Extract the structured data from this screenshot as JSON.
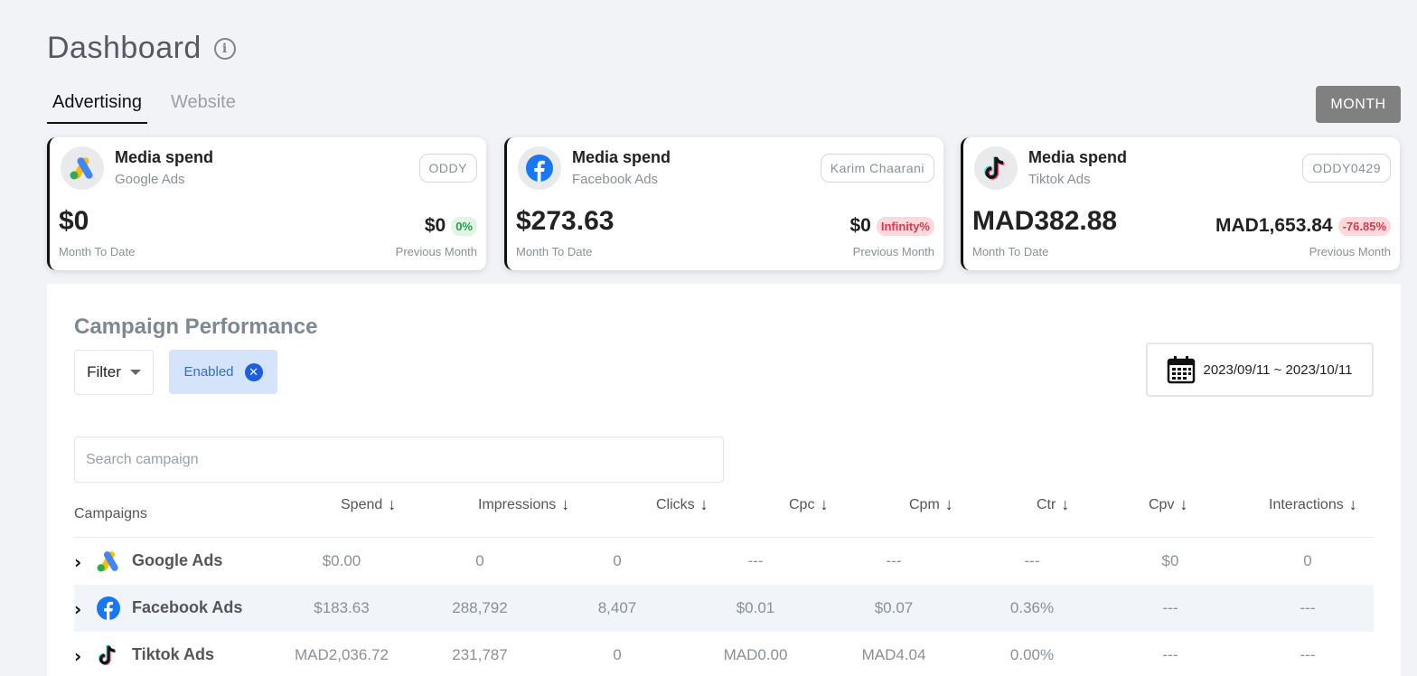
{
  "page": {
    "title": "Dashboard",
    "tabs": [
      {
        "label": "Advertising",
        "active": true
      },
      {
        "label": "Website",
        "active": false
      }
    ],
    "period_button": "MONTH"
  },
  "cards": [
    {
      "icon": "google-ads-icon",
      "title": "Media spend",
      "platform": "Google Ads",
      "account": "ODDY",
      "month_to_date": "$0",
      "month_to_date_label": "Month To Date",
      "previous": "$0",
      "change": "0%",
      "change_status": "positive",
      "previous_label": "Previous Month"
    },
    {
      "icon": "facebook-icon",
      "title": "Media spend",
      "platform": "Facebook Ads",
      "account": "Karim Chaarani",
      "month_to_date": "$273.63",
      "month_to_date_label": "Month To Date",
      "previous": "$0",
      "change": "Infinity%",
      "change_status": "negative",
      "previous_label": "Previous Month"
    },
    {
      "icon": "tiktok-icon",
      "title": "Media spend",
      "platform": "Tiktok Ads",
      "account": "ODDY0429",
      "month_to_date": "MAD382.88",
      "month_to_date_label": "Month To Date",
      "previous": "MAD1,653.84",
      "change": "-76.85%",
      "change_status": "negative",
      "previous_label": "Previous Month"
    }
  ],
  "campaign_performance": {
    "title": "Campaign Performance",
    "filter_label": "Filter",
    "active_filter": "Enabled",
    "date_range": "2023/09/11 ~ 2023/10/11",
    "search_placeholder": "Search campaign",
    "campaigns_header": "Campaigns",
    "columns": [
      "Spend",
      "Impressions",
      "Clicks",
      "Cpc",
      "Cpm",
      "Ctr",
      "Cpv",
      "Interactions"
    ],
    "rows": [
      {
        "icon": "google-ads-icon",
        "name": "Google Ads",
        "values": [
          "$0.00",
          "0",
          "0",
          "---",
          "---",
          "---",
          "$0",
          "0"
        ]
      },
      {
        "icon": "facebook-icon",
        "name": "Facebook Ads",
        "values": [
          "$183.63",
          "288,792",
          "8,407",
          "$0.01",
          "$0.07",
          "0.36%",
          "---",
          "---"
        ]
      },
      {
        "icon": "tiktok-icon",
        "name": "Tiktok Ads",
        "values": [
          "MAD2,036.72",
          "231,787",
          "0",
          "MAD0.00",
          "MAD4.04",
          "0.00%",
          "---",
          "---"
        ]
      }
    ]
  },
  "colors": {
    "google_blue": "#4285F4",
    "google_yellow": "#FBBC04",
    "google_green": "#34A853",
    "facebook_blue": "#1877F2",
    "tiktok_cyan": "#25F4EE",
    "tiktok_red": "#FE2C55",
    "badge_green_bg": "#e1f4e5",
    "badge_red_bg": "#fcd9dc"
  }
}
